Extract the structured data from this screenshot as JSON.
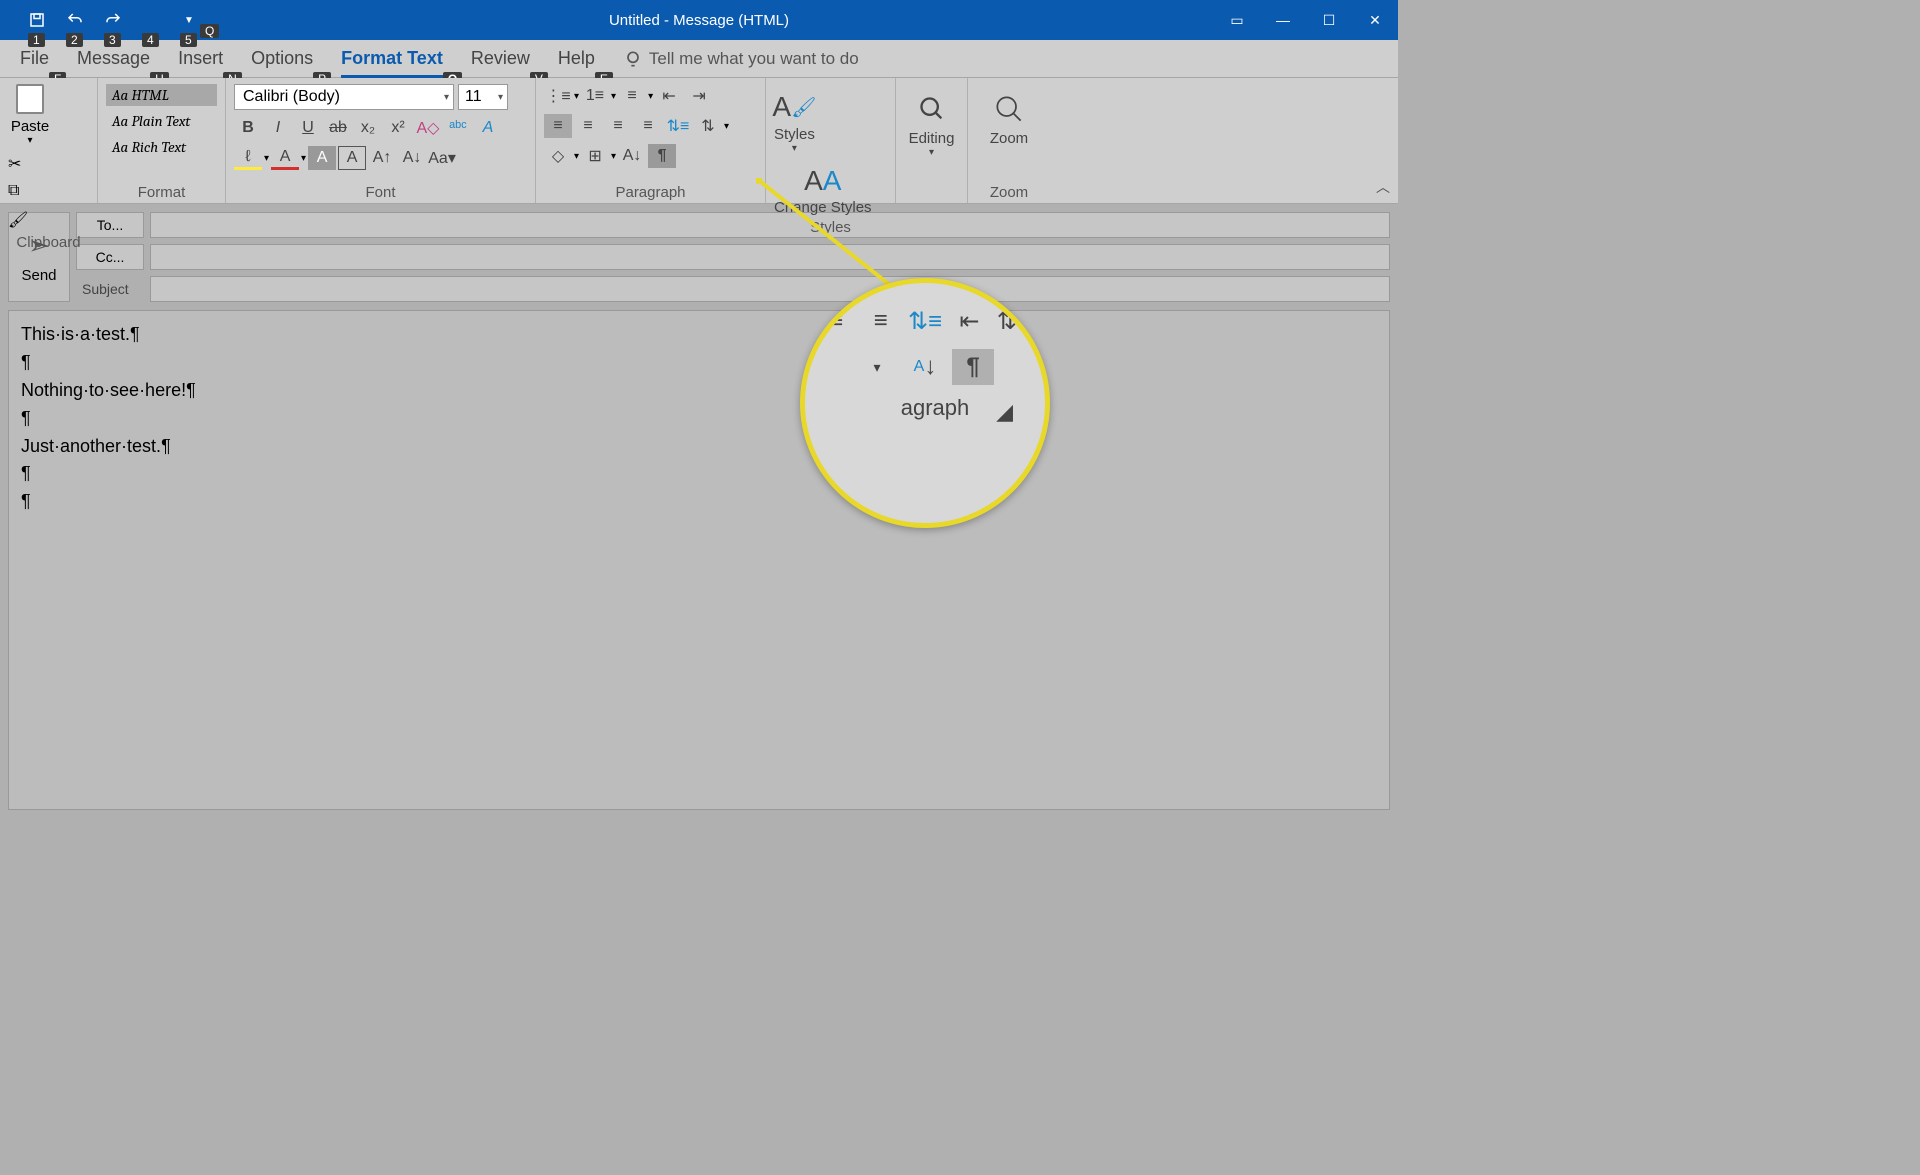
{
  "title": "Untitled  -  Message (HTML)",
  "qat_badges": [
    "1",
    "2",
    "3",
    "4",
    "5"
  ],
  "tabs": {
    "file": "File",
    "message": "Message",
    "insert": "Insert",
    "options": "Options",
    "format_text": "Format Text",
    "review": "Review",
    "help": "Help",
    "tell_me": "Tell me what you want to do"
  },
  "tab_hotkeys": {
    "file": "F",
    "message": "H",
    "insert": "N",
    "options": "P",
    "format_text": "O",
    "review": "V",
    "help": "E",
    "tell_me": "Q"
  },
  "ribbon": {
    "clipboard": {
      "label": "Clipboard",
      "paste": "Paste"
    },
    "format": {
      "label": "Format",
      "html": "Aa HTML",
      "plain": "Aa Plain Text",
      "rich": "Aa Rich Text"
    },
    "font": {
      "label": "Font",
      "name": "Calibri (Body)",
      "size": "11"
    },
    "paragraph": {
      "label": "Paragraph"
    },
    "styles": {
      "label": "Styles",
      "styles": "Styles",
      "change": "Change Styles"
    },
    "editing": {
      "label": "Editing"
    },
    "zoom": {
      "label": "Zoom",
      "zoom": "Zoom"
    }
  },
  "compose": {
    "send": "Send",
    "to": "To...",
    "cc": "Cc...",
    "subject": "Subject"
  },
  "body_lines": [
    "This·is·a·test.¶",
    "¶",
    "Nothing·to·see·here!¶",
    "¶",
    "Just·another·test.¶",
    "¶",
    "¶"
  ],
  "magnifier_label": "agraph"
}
